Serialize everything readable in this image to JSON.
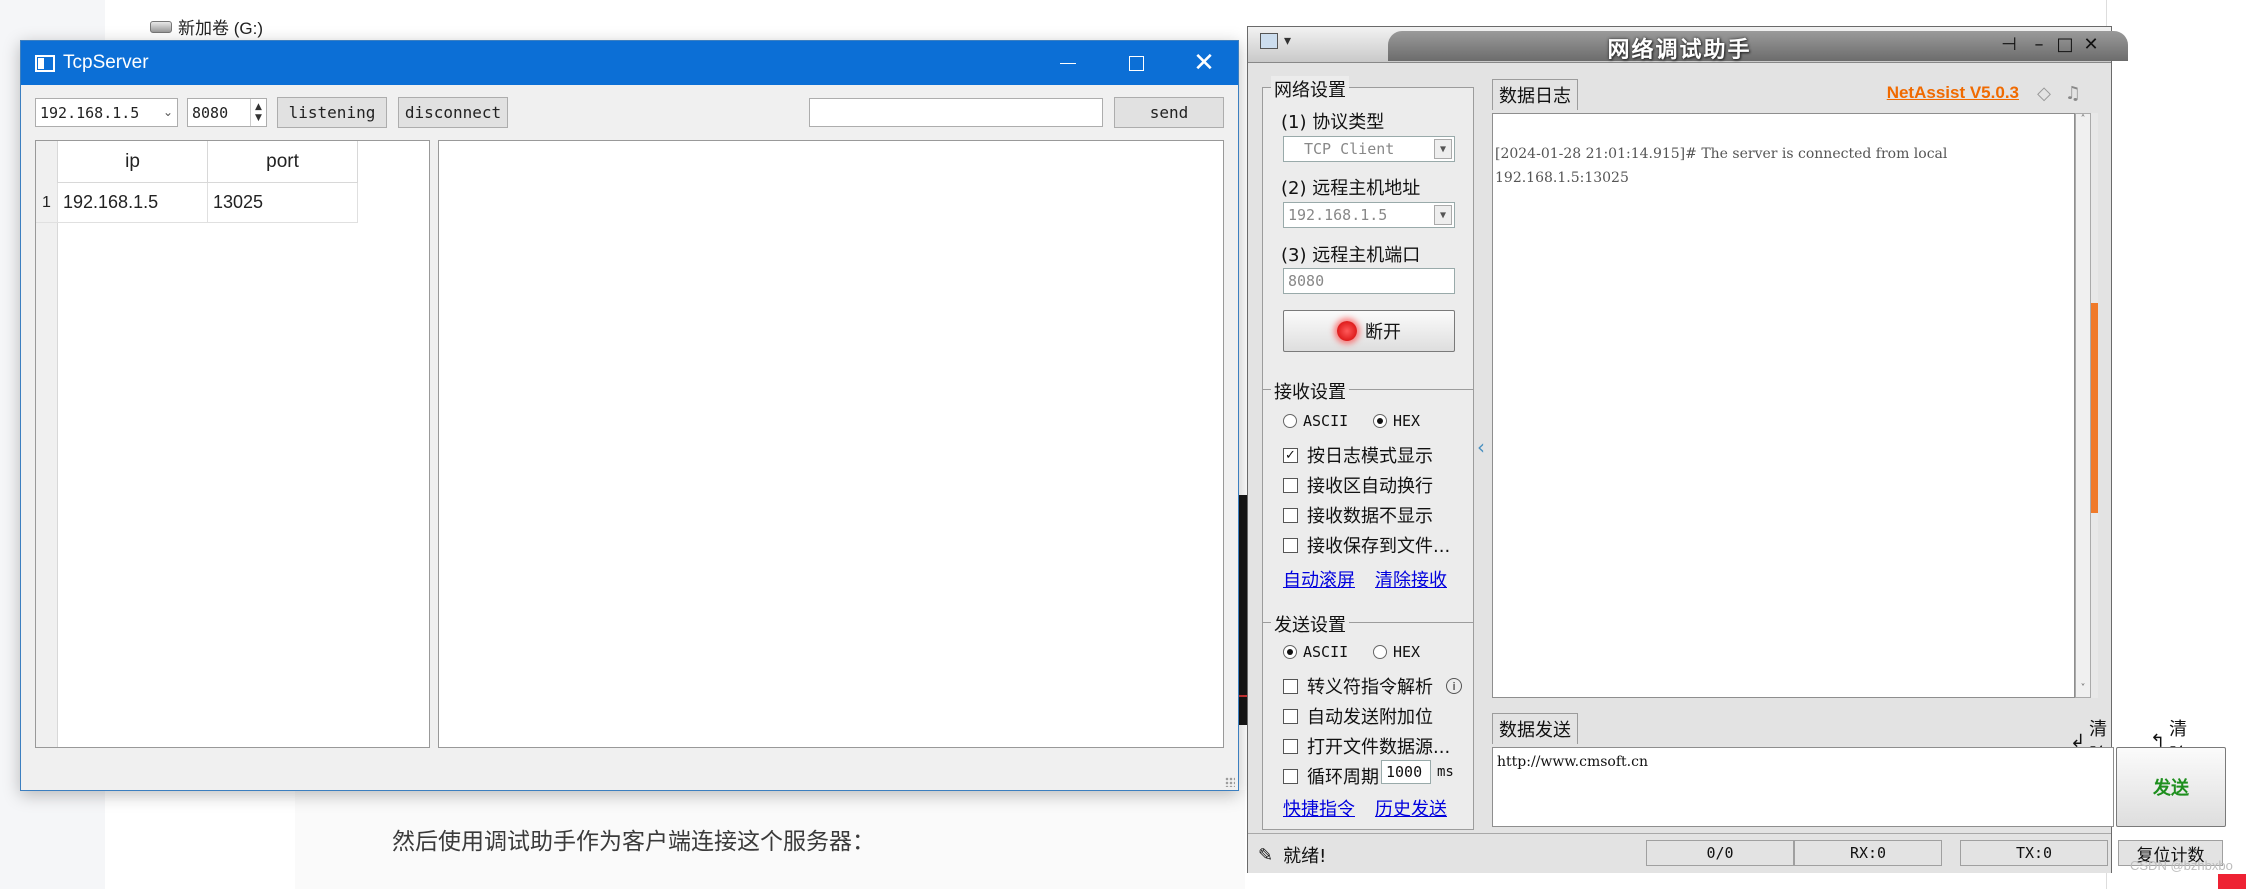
{
  "background": {
    "drive_label": "新加卷 (G:)",
    "article_text": "然后使用调试助手作为客户端连接这个服务器：",
    "watermark": "CSDN @bzhbxbo"
  },
  "tcpserver": {
    "title": "TcpServer",
    "ip_select": "192.168.1.5",
    "port_value": "8080",
    "listening_label": "listening",
    "disconnect_label": "disconnect",
    "send_input_value": "",
    "send_label": "send",
    "table": {
      "headers": [
        "ip",
        "port"
      ],
      "rows": [
        {
          "index": "1",
          "ip": "192.168.1.5",
          "port": "13025"
        }
      ]
    },
    "log_text": ""
  },
  "netassist": {
    "title": "网络调试助手",
    "network_settings": {
      "legend": "网络设置",
      "protocol_label": "(1) 协议类型",
      "protocol_value": "TCP Client",
      "host_label": "(2) 远程主机地址",
      "host_value": "192.168.1.5",
      "port_label": "(3) 远程主机端口",
      "port_value": "8080",
      "disconnect_label": "断开"
    },
    "receive_settings": {
      "legend": "接收设置",
      "ascii": "ASCII",
      "hex": "HEX",
      "selected": "HEX",
      "log_mode": "按日志模式显示",
      "auto_wrap": "接收区自动换行",
      "hide_data": "接收数据不显示",
      "save_file": "接收保存到文件...",
      "auto_scroll": "自动滚屏",
      "clear_receive": "清除接收"
    },
    "send_settings": {
      "legend": "发送设置",
      "ascii": "ASCII",
      "hex": "HEX",
      "selected": "ASCII",
      "escape_parse": "转义符指令解析",
      "append_bit": "自动发送附加位",
      "open_file": "打开文件数据源...",
      "loop_period": "循环周期",
      "period_value": "1000",
      "period_unit": "ms",
      "shortcut": "快捷指令",
      "history": "历史发送"
    },
    "log_tab": "数据日志",
    "brand": "NetAssist V5.0.3",
    "log_lines": [
      "[2024-01-28 21:01:14.915]# The server is connected from local",
      "192.168.1.5:13025"
    ],
    "send_tab": "数据发送",
    "clear1": "清除",
    "clear2": "清除",
    "send_text": "http://www.cmsoft.cn",
    "send_button": "发送",
    "status": {
      "ready": "就绪!",
      "count": "0/0",
      "rx": "RX:0",
      "tx": "TX:0",
      "reset": "复位计数"
    }
  }
}
